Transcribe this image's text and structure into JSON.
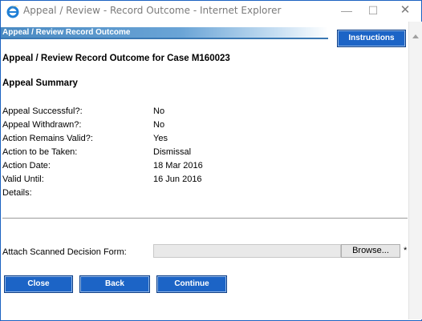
{
  "window": {
    "title": "Appeal / Review - Record Outcome - Internet Explorer",
    "minimize_glyph": "—",
    "maximize_glyph": "☐",
    "close_glyph": "✕"
  },
  "banner": {
    "text": "Appeal / Review Record Outcome"
  },
  "toolbar": {
    "instructions_label": "Instructions"
  },
  "page": {
    "title": "Appeal / Review Record Outcome for Case M160023",
    "section_title": "Appeal Summary"
  },
  "summary": {
    "fields": [
      {
        "label": "Appeal Successful?:",
        "value": "No"
      },
      {
        "label": "Appeal Withdrawn?:",
        "value": "No"
      },
      {
        "label": "Action Remains Valid?:",
        "value": "Yes"
      },
      {
        "label": "Action to be Taken:",
        "value": "Dismissal"
      },
      {
        "label": "Action Date:",
        "value": "18 Mar 2016"
      },
      {
        "label": "Valid Until:",
        "value": "16 Jun 2016"
      },
      {
        "label": "Details:",
        "value": ""
      }
    ]
  },
  "attach": {
    "label": "Attach Scanned Decision Form:",
    "browse_label": "Browse...",
    "required_mark": "*"
  },
  "actions": {
    "close_label": "Close",
    "back_label": "Back",
    "continue_label": "Continue"
  },
  "colors": {
    "button_blue": "#1c64c6",
    "banner_blue": "#4a8ac2",
    "window_border": "#1c63c2"
  },
  "icons": {
    "browser": "internet-explorer-icon"
  }
}
